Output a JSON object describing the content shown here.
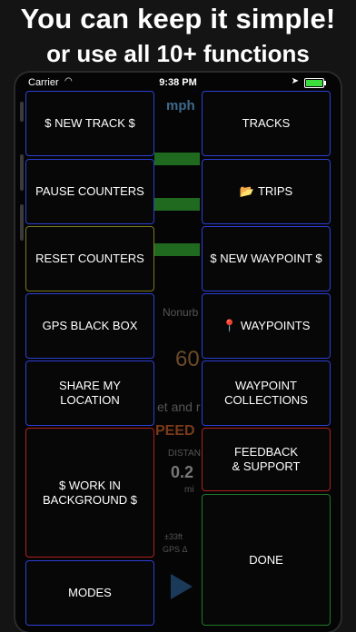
{
  "banner": {
    "line1": "You can keep it simple!",
    "line2": "or use all 10+ functions"
  },
  "status_bar": {
    "carrier": "Carrier",
    "wifi_icon": "wifi-icon",
    "time": "9:38 PM",
    "location_icon": "location-arrow-icon",
    "battery_icon": "battery-icon"
  },
  "background_app": {
    "unit": "mph",
    "nonurban_fragment": "Nonurb",
    "big_number_fragment": "60",
    "set_text_fragment": "et and r",
    "speed_fragment": "PEED",
    "distance_label_fragment": "DISTAN",
    "distance_value_fragment": "0.2",
    "distance_unit_fragment": "mi",
    "accuracy_fragment": "±33ft",
    "gps_fragment": "GPS Δ"
  },
  "menu": {
    "new_track": "$ NEW TRACK $",
    "tracks": "TRACKS",
    "pause_counters": "PAUSE COUNTERS",
    "trips_icon": "📂",
    "trips": "TRIPS",
    "reset_counters": "RESET COUNTERS",
    "new_waypoint": "$ NEW WAYPOINT $",
    "gps_black_box": "GPS BLACK BOX",
    "waypoints_icon": "📍",
    "waypoints": "WAYPOINTS",
    "share_location": "SHARE MY\nLOCATION",
    "waypoint_collections": "WAYPOINT\nCOLLECTIONS",
    "work_in_background": "$ WORK IN\nBACKGROUND $",
    "feedback_support": "FEEDBACK\n& SUPPORT",
    "modes": "MODES",
    "done": "DONE"
  },
  "colors": {
    "blue_border": "#2c3fd6",
    "olive_border": "#7a7a20",
    "red_border": "#b02020",
    "green_border": "#1f7a2a"
  }
}
